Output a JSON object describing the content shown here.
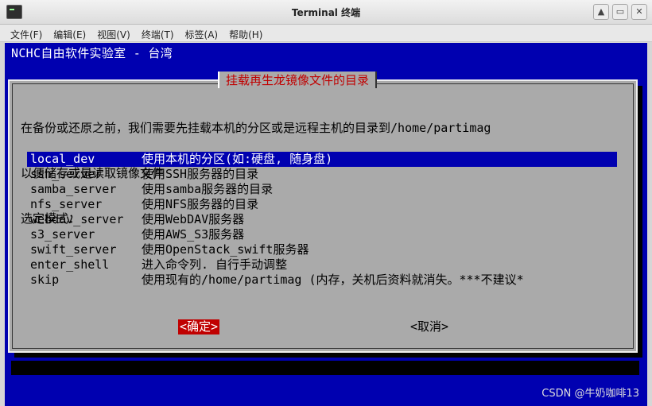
{
  "window": {
    "title": "Terminal 终端",
    "controls": [
      "▲",
      "▭",
      "✕"
    ]
  },
  "menu": [
    "文件(F)",
    "编辑(E)",
    "视图(V)",
    "终端(T)",
    "标签(A)",
    "帮助(H)"
  ],
  "terminal": {
    "header": "NCHC自由软件实验室 - 台湾",
    "dialog": {
      "title": "挂载再生龙镜像文件的目录",
      "prompt_lines": [
        "在备份或还原之前，我们需要先挂载本机的分区或是远程主机的目录到/home/partimag",
        "以便储存或是读取镜像文件",
        "选定模式："
      ],
      "options": [
        {
          "key": "local_dev",
          "desc": "使用本机的分区(如:硬盘, 随身盘)"
        },
        {
          "key": "ssh_server",
          "desc": "使用SSH服务器的目录"
        },
        {
          "key": "samba_server",
          "desc": "使用samba服务器的目录"
        },
        {
          "key": "nfs_server",
          "desc": "使用NFS服务器的目录"
        },
        {
          "key": "webdav_server",
          "desc": "使用WebDAV服务器"
        },
        {
          "key": "s3_server",
          "desc": "使用AWS_S3服务器"
        },
        {
          "key": "swift_server",
          "desc": "使用OpenStack_swift服务器"
        },
        {
          "key": "enter_shell",
          "desc": "进入命令列. 自行手动调整"
        },
        {
          "key": "skip",
          "desc": "使用现有的/home/partimag (内存，关机后资料就消失。***不建议*"
        }
      ],
      "selected_index": 0,
      "ok_label": "<确定>",
      "cancel_label": "<取消>"
    },
    "watermark": "CSDN @牛奶咖啡13"
  }
}
